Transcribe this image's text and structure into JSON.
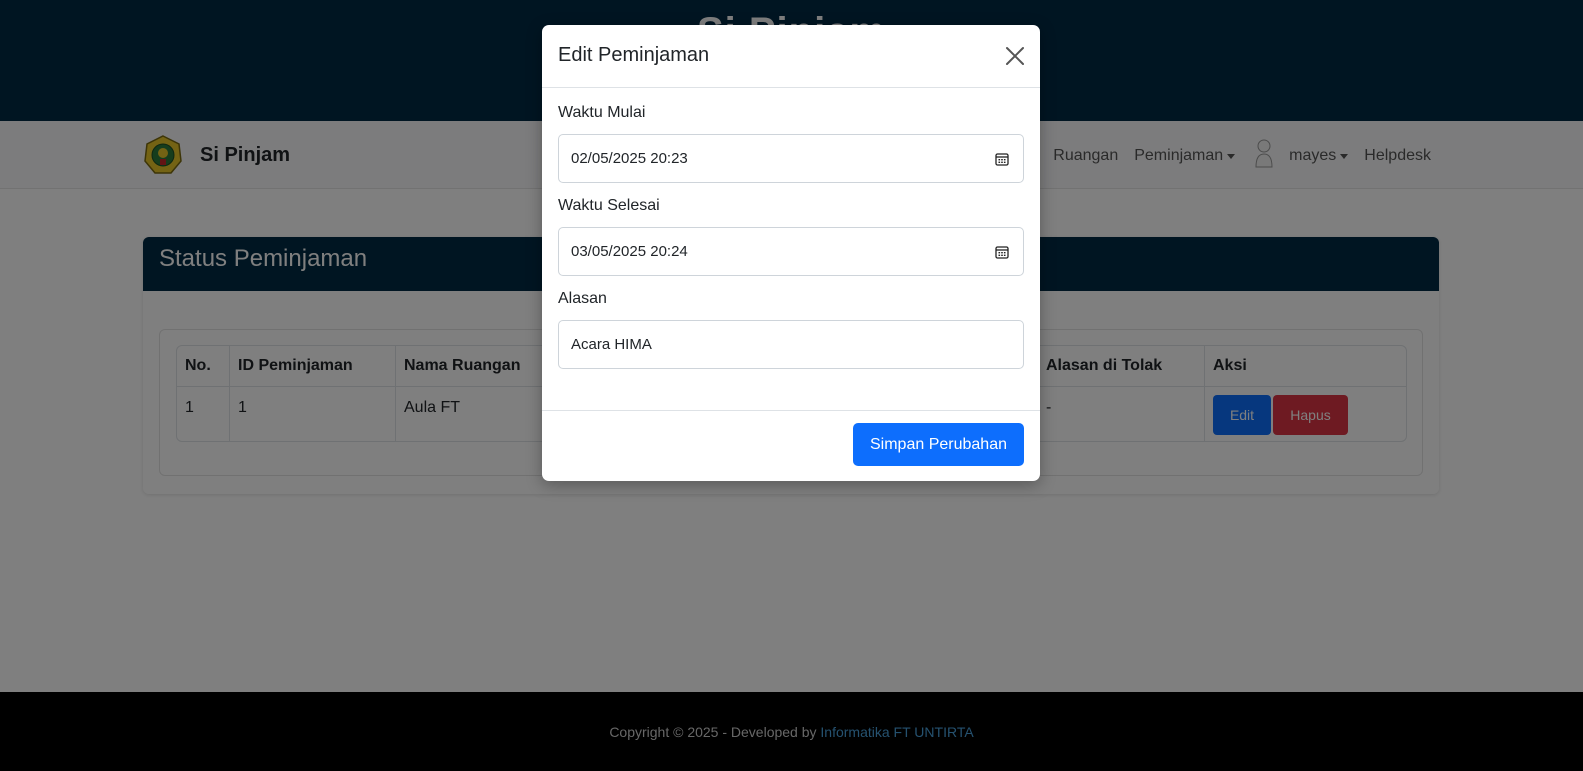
{
  "banner": {
    "title": "Si Pinjam"
  },
  "navbar": {
    "brand": "Si Pinjam",
    "links": {
      "ruangan": "Ruangan",
      "peminjaman": "Peminjaman",
      "user": "mayes",
      "helpdesk": "Helpdesk"
    }
  },
  "card": {
    "title": "Status Peminjaman",
    "table": {
      "headers": {
        "no": "No.",
        "id": "ID Peminjaman",
        "nama": "Nama Ruangan",
        "alasan_tolak": "Alasan di Tolak",
        "aksi": "Aksi"
      },
      "rows": [
        {
          "no": "1",
          "id": "1",
          "nama": "Aula FT",
          "alasan_tolak": "-",
          "edit": "Edit",
          "hapus": "Hapus"
        }
      ]
    }
  },
  "modal": {
    "title": "Edit Peminjaman",
    "fields": {
      "waktu_mulai": {
        "label": "Waktu Mulai",
        "value": "02/05/2025 20:23"
      },
      "waktu_selesai": {
        "label": "Waktu Selesai",
        "value": "03/05/2025 20:24"
      },
      "alasan": {
        "label": "Alasan",
        "value": "Acara HIMA"
      }
    },
    "save_label": "Simpan Perubahan"
  },
  "footer": {
    "text": "Copyright © 2025 - Developed by",
    "link": "Informatika FT UNTIRTA"
  },
  "colors": {
    "header_bg": "#002b45",
    "primary": "#0d6efd",
    "danger": "#dc3545",
    "footer_link": "#4aa3df"
  }
}
